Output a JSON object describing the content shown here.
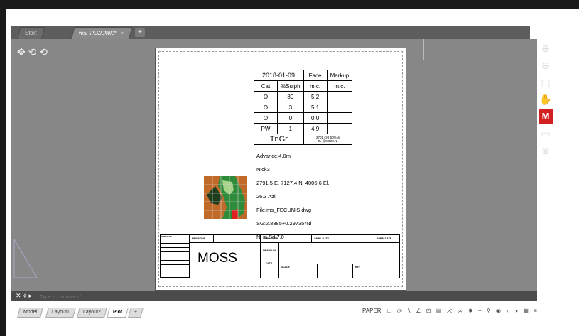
{
  "tabs": [
    {
      "label": "Start"
    },
    {
      "label": "ms_FECUNIS*"
    }
  ],
  "tab_close": "×",
  "tab_add": "+",
  "nav_icons": "✥ ⟲ ⟲",
  "table": {
    "date": "2018-01-09",
    "face": "Face",
    "markup": "Markup",
    "cat": "Cat",
    "sulph": "%Sulph",
    "mc1": "m.c.",
    "mc2": "m.c.",
    "rows": [
      [
        "O",
        "80",
        "5.2"
      ],
      [
        "O",
        "3",
        "5.1"
      ],
      [
        "O",
        "0",
        "0.0"
      ],
      [
        "PW",
        "1",
        "4.9"
      ]
    ],
    "tngr": "TnGr",
    "tngr_note1": "2701 @2.60%Ni",
    "tngr_note2": "0L @0.00%Ni"
  },
  "notes": [
    "Advance:4.0m",
    "Nick3",
    "2791.5 E, 7127.4 N, 4006.6 El.",
    "26.3 Azi.",
    "File:ms_FECUNIS.dwg",
    "SG:2.8385+0.29735*Ni",
    "Ni in Sd 7.0"
  ],
  "titleblock": {
    "moss": "MOSS",
    "label_approval": "APPROVAL",
    "label_revisions": "REVISIONS",
    "label_appr": "APPR. DATE",
    "label_appr2": "APPR. DATE",
    "label_appr3": "APPR. DATE",
    "label_drawn": "DRAWN BY",
    "label_date": "DATE",
    "label_scale": "SCALE",
    "label_ref": "REF"
  },
  "command": {
    "placeholder": "Type a command"
  },
  "layout_tabs": [
    {
      "label": "Model"
    },
    {
      "label": "Layout1"
    },
    {
      "label": "Layout2"
    },
    {
      "label": "Plot"
    }
  ],
  "layout_add": "+",
  "status": {
    "paper": "PAPER",
    "icons": [
      "∟",
      "◎",
      "∖",
      "∠",
      "⊡",
      "▤",
      "⋌",
      "⋌",
      "✸",
      "+",
      "⚲",
      "◉",
      "◐",
      "◑",
      "▦",
      "≡"
    ]
  },
  "colors": {
    "canvas": "#878787",
    "accent_red": "#d32020",
    "map_green": "#2e8b3a",
    "map_orange": "#c06a2a"
  }
}
